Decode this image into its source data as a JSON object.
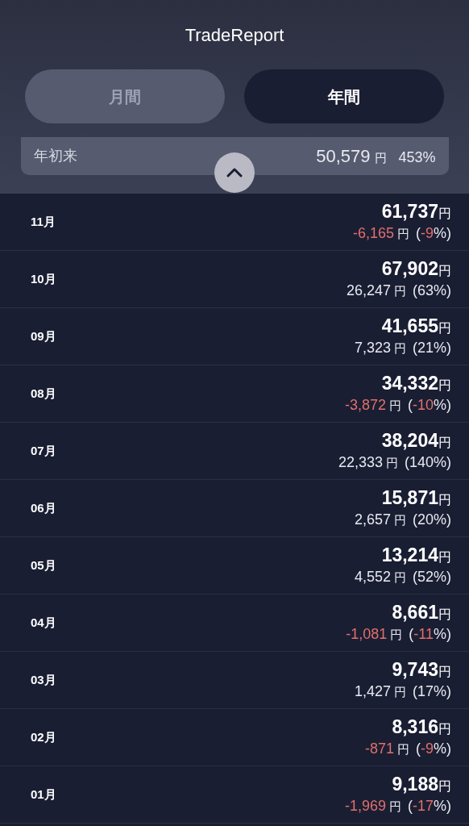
{
  "title": "TradeReport",
  "tabs": [
    {
      "label": "月間",
      "selected": false
    },
    {
      "label": "年間",
      "selected": true
    }
  ],
  "summary": {
    "label": "年初来",
    "amount": "50,579",
    "unit": "円",
    "percent": "453%"
  },
  "rows": [
    {
      "month": "11月",
      "total": "61,737",
      "total_unit": "円",
      "change": "-6,165",
      "change_unit": "円",
      "open": "(",
      "percent": "-9",
      "close": "%)",
      "negative": true
    },
    {
      "month": "10月",
      "total": "67,902",
      "total_unit": "円",
      "change": "26,247",
      "change_unit": "円",
      "open": "(",
      "percent": "63",
      "close": "%)",
      "negative": false
    },
    {
      "month": "09月",
      "total": "41,655",
      "total_unit": "円",
      "change": "7,323",
      "change_unit": "円",
      "open": "(",
      "percent": "21",
      "close": "%)",
      "negative": false
    },
    {
      "month": "08月",
      "total": "34,332",
      "total_unit": "円",
      "change": "-3,872",
      "change_unit": "円",
      "open": "(",
      "percent": "-10",
      "close": "%)",
      "negative": true
    },
    {
      "month": "07月",
      "total": "38,204",
      "total_unit": "円",
      "change": "22,333",
      "change_unit": "円",
      "open": "(",
      "percent": "140",
      "close": "%)",
      "negative": false
    },
    {
      "month": "06月",
      "total": "15,871",
      "total_unit": "円",
      "change": "2,657",
      "change_unit": "円",
      "open": "(",
      "percent": "20",
      "close": "%)",
      "negative": false
    },
    {
      "month": "05月",
      "total": "13,214",
      "total_unit": "円",
      "change": "4,552",
      "change_unit": "円",
      "open": "(",
      "percent": "52",
      "close": "%)",
      "negative": false
    },
    {
      "month": "04月",
      "total": "8,661",
      "total_unit": "円",
      "change": "-1,081",
      "change_unit": "円",
      "open": "(",
      "percent": "-11",
      "close": "%)",
      "negative": true
    },
    {
      "month": "03月",
      "total": "9,743",
      "total_unit": "円",
      "change": "1,427",
      "change_unit": "円",
      "open": "(",
      "percent": "17",
      "close": "%)",
      "negative": false
    },
    {
      "month": "02月",
      "total": "8,316",
      "total_unit": "円",
      "change": "-871",
      "change_unit": "円",
      "open": "(",
      "percent": "-9",
      "close": "%)",
      "negative": true
    },
    {
      "month": "01月",
      "total": "9,188",
      "total_unit": "円",
      "change": "-1,969",
      "change_unit": "円",
      "open": "(",
      "percent": "-17",
      "close": "%)",
      "negative": true
    }
  ]
}
